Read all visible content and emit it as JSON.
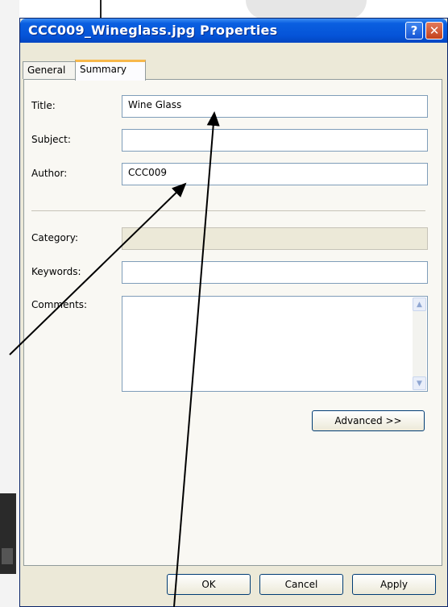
{
  "window": {
    "title": "CCC009_Wineglass.jpg Properties"
  },
  "titlebar_buttons": {
    "help": "?",
    "close": "✕"
  },
  "tabs": [
    {
      "label": "General",
      "selected": false
    },
    {
      "label": "Summary",
      "selected": true
    }
  ],
  "fields": {
    "title": {
      "label": "Title:",
      "value": "Wine Glass"
    },
    "subject": {
      "label": "Subject:",
      "value": ""
    },
    "author": {
      "label": "Author:",
      "value": "CCC009"
    },
    "category": {
      "label": "Category:",
      "value": "",
      "disabled": true
    },
    "keywords": {
      "label": "Keywords:",
      "value": ""
    },
    "comments": {
      "label": "Comments:",
      "value": ""
    }
  },
  "buttons": {
    "advanced": "Advanced >>",
    "ok": "OK",
    "cancel": "Cancel",
    "apply": "Apply"
  },
  "colors": {
    "titlebar": "#0554d8",
    "dialog": "#ece9d8",
    "tab_highlight": "#f7b84b",
    "close": "#c3411b"
  },
  "icons": [
    "help-icon",
    "close-icon",
    "scroll-up-icon",
    "scroll-down-icon",
    "annotation-arrow"
  ]
}
